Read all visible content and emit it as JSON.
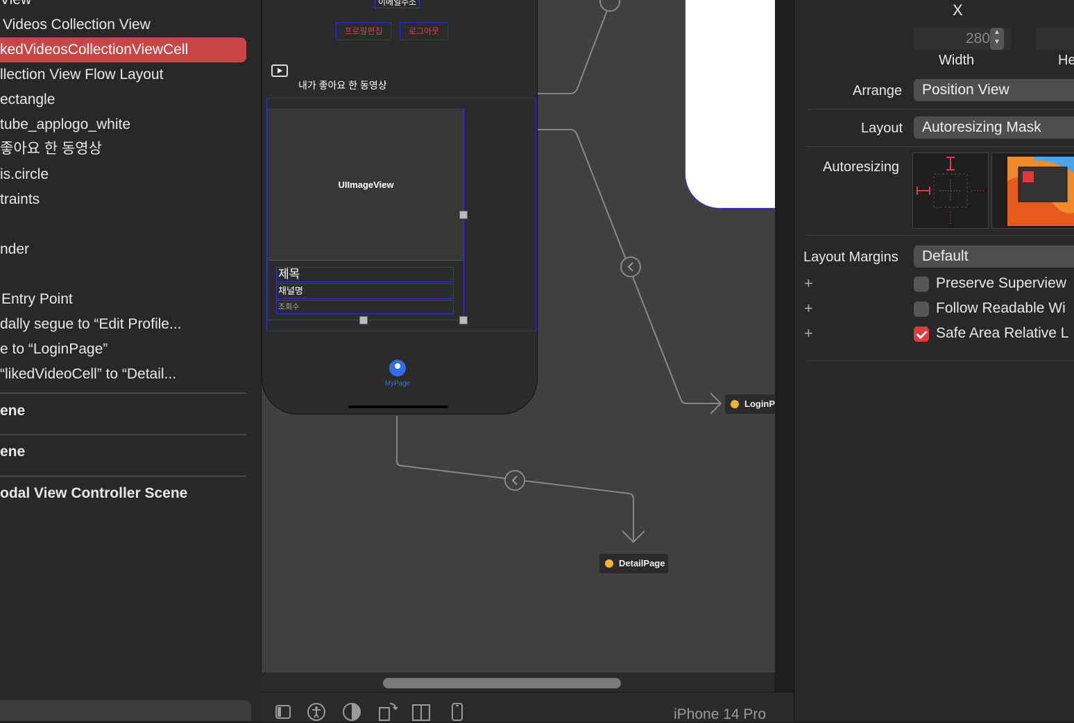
{
  "outline": {
    "items": [
      {
        "label": "View",
        "type": "item"
      },
      {
        "label": "Videos Collection View",
        "type": "item"
      },
      {
        "label": "kedVideosCollectionViewCell",
        "type": "selected"
      },
      {
        "label": "llection View Flow Layout",
        "type": "item"
      },
      {
        "label": "ectangle",
        "type": "item"
      },
      {
        "label": "tube_applogo_white",
        "type": "item"
      },
      {
        "label": "좋아요 한 동영상",
        "type": "item"
      },
      {
        "label": "is.circle",
        "type": "item"
      },
      {
        "label": "traints",
        "type": "item"
      },
      {
        "label": "nder",
        "type": "item"
      },
      {
        "label": "Entry Point",
        "type": "item"
      },
      {
        "label": "dally segue to “Edit Profile...",
        "type": "item"
      },
      {
        "label": "e to “LoginPage”",
        "type": "item"
      },
      {
        "label": "“likedVideoCell” to “Detail...",
        "type": "item"
      },
      {
        "label": "ene",
        "type": "scene"
      },
      {
        "label": "ene",
        "type": "scene"
      },
      {
        "label": "odal View Controller Scene",
        "type": "scene"
      }
    ]
  },
  "canvas": {
    "top_label": "이메일주소",
    "edit_profile_button": "프로필편집",
    "logout_button": "로그아웃",
    "liked_videos_label": "내가 좋아요 한 동영상",
    "image_view_label": "UIImageView",
    "cell_title": "제목",
    "cell_channel": "채널명",
    "cell_views": "조회수",
    "tab_label": "MyPage",
    "login_scene_label": "LoginPa",
    "detail_scene_label": "DetailPage",
    "device_label": "iPhone 14 Pro"
  },
  "inspector": {
    "x_label": "X",
    "width_value": "280",
    "width_label": "Width",
    "height_label": "He",
    "arrange_label": "Arrange",
    "arrange_value": "Position View",
    "layout_label": "Layout",
    "layout_value": "Autoresizing Mask",
    "autoresizing_label": "Autoresizing",
    "layout_margins_label": "Layout Margins",
    "layout_margins_value": "Default",
    "checkboxes": [
      {
        "label": "Preserve Superview",
        "checked": false
      },
      {
        "label": "Follow Readable Wi",
        "checked": false
      },
      {
        "label": "Safe Area Relative L",
        "checked": true
      }
    ]
  },
  "colors": {
    "selection": "#c84646",
    "accent_blue": "#2f6fe8",
    "check_red": "#e03a3a"
  }
}
